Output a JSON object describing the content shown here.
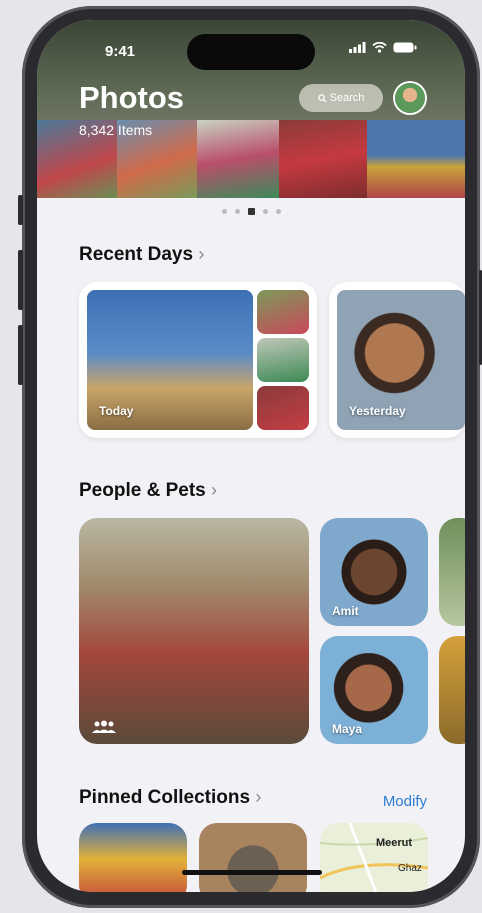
{
  "status": {
    "time": "9:41"
  },
  "header": {
    "title": "Photos",
    "item_count": "8,342 Items",
    "search_label": "Search"
  },
  "recent_days": {
    "title": "Recent Days",
    "cards": [
      {
        "label": "Today"
      },
      {
        "label": "Yesterday"
      }
    ]
  },
  "people_pets": {
    "title": "People & Pets",
    "people": [
      {
        "name": "Amit"
      },
      {
        "name": "Maya"
      }
    ]
  },
  "pinned": {
    "title": "Pinned Collections",
    "modify_label": "Modify",
    "map_labels": [
      "Meerut",
      "Ghaz"
    ]
  },
  "colors": {
    "accent": "#2b7cd3",
    "background": "#f2f2f6",
    "phone_frame": "#2b2b2f"
  },
  "icons": [
    "search-icon",
    "signal-icon",
    "wifi-icon",
    "battery-icon",
    "chevron-right-icon",
    "group-icon"
  ]
}
